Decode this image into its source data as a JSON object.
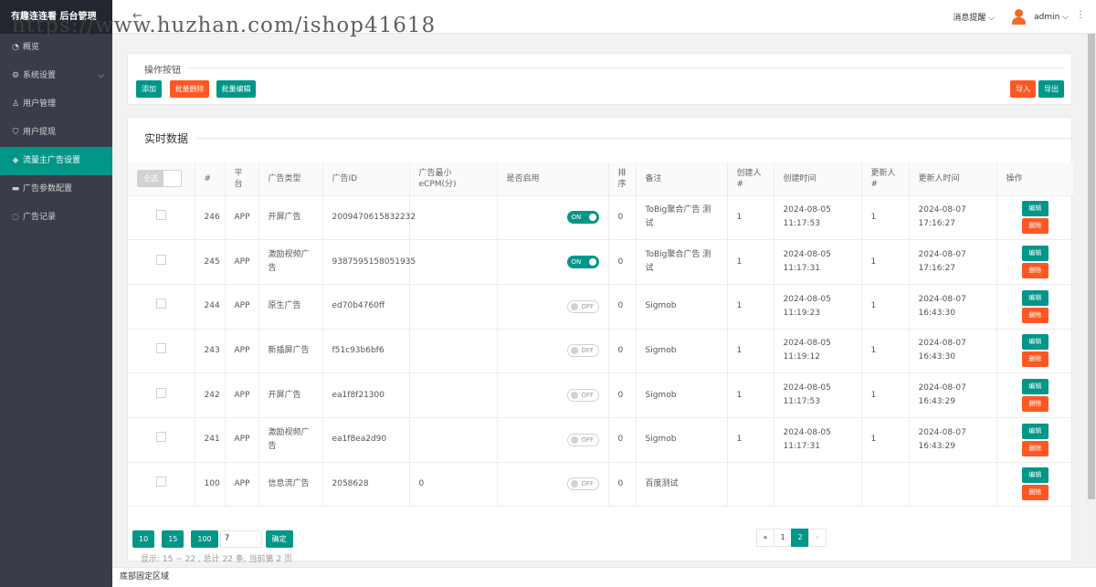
{
  "app": {
    "title": "有趣连连看 后台管理",
    "watermark": "https://www.huzhan.com/ishop41618"
  },
  "sidebar": {
    "items": [
      {
        "label": "概览",
        "icon": "dashboard-icon"
      },
      {
        "label": "系统设置",
        "icon": "gear-icon"
      },
      {
        "label": "用户管理",
        "icon": "user-icon"
      },
      {
        "label": "用户提现",
        "icon": "shield-icon"
      },
      {
        "label": "流量主广告设置",
        "icon": "diamond-icon",
        "active": true
      },
      {
        "label": "广告参数配置",
        "icon": "gamepad-icon"
      },
      {
        "label": "广告记录",
        "icon": "record-icon"
      }
    ]
  },
  "header": {
    "notifications": "消息提醒",
    "user": "admin"
  },
  "ops": {
    "legend": "操作按钮",
    "add": "添加",
    "batch_delete": "批量删除",
    "batch_edit": "批量编辑",
    "import": "导入",
    "export": "导出"
  },
  "table": {
    "title": "实时数据",
    "select_all": "全选",
    "columns": [
      "#",
      "平台",
      "广告类型",
      "广告ID",
      "广告最小eCPM(分)",
      "是否启用",
      "排序",
      "备注",
      "创建人#",
      "创建时间",
      "更新人#",
      "更新人时间",
      "操作"
    ],
    "rows": [
      {
        "id": "246",
        "platform": "APP",
        "type": "开屏广告",
        "ad_id": "2009470615832232",
        "ecpm": "",
        "enabled": "ON",
        "sort": "0",
        "note": "ToBig聚合广告 测试",
        "creator": "1",
        "created": "2024-08-05 11:17:53",
        "updater": "1",
        "updated": "2024-08-07 17:16:27"
      },
      {
        "id": "245",
        "platform": "APP",
        "type": "激励视频广告",
        "ad_id": "9387595158051935",
        "ecpm": "",
        "enabled": "ON",
        "sort": "0",
        "note": "ToBig聚合广告 测试",
        "creator": "1",
        "created": "2024-08-05 11:17:31",
        "updater": "1",
        "updated": "2024-08-07 17:16:27"
      },
      {
        "id": "244",
        "platform": "APP",
        "type": "原生广告",
        "ad_id": "ed70b4760ff",
        "ecpm": "",
        "enabled": "OFF",
        "sort": "0",
        "note": "Sigmob",
        "creator": "1",
        "created": "2024-08-05 11:19:23",
        "updater": "1",
        "updated": "2024-08-07 16:43:30"
      },
      {
        "id": "243",
        "platform": "APP",
        "type": "新插屏广告",
        "ad_id": "f51c93b6bf6",
        "ecpm": "",
        "enabled": "OFF",
        "sort": "0",
        "note": "Sigmob",
        "creator": "1",
        "created": "2024-08-05 11:19:12",
        "updater": "1",
        "updated": "2024-08-07 16:43:30"
      },
      {
        "id": "242",
        "platform": "APP",
        "type": "开屏广告",
        "ad_id": "ea1f8f21300",
        "ecpm": "",
        "enabled": "OFF",
        "sort": "0",
        "note": "Sigmob",
        "creator": "1",
        "created": "2024-08-05 11:17:53",
        "updater": "1",
        "updated": "2024-08-07 16:43:29"
      },
      {
        "id": "241",
        "platform": "APP",
        "type": "激励视频广告",
        "ad_id": "ea1f8ea2d90",
        "ecpm": "",
        "enabled": "OFF",
        "sort": "0",
        "note": "Sigmob",
        "creator": "1",
        "created": "2024-08-05 11:17:31",
        "updater": "1",
        "updated": "2024-08-07 16:43:29"
      },
      {
        "id": "100",
        "platform": "APP",
        "type": "信息流广告",
        "ad_id": "2058628",
        "ecpm": "0",
        "enabled": "OFF",
        "sort": "0",
        "note": "百度测试",
        "creator": "",
        "created": "",
        "updater": "",
        "updated": ""
      }
    ],
    "edit_label": "编辑",
    "delete_label": "删除"
  },
  "pager": {
    "sizes": [
      "10",
      "15",
      "100"
    ],
    "input_value": "7",
    "confirm": "确定",
    "info": "显示: 15 ~ 22 , 总计 22 条,  当前第 2 页",
    "prev": "«",
    "pages": [
      "1",
      "2"
    ],
    "current": "2",
    "next": "»"
  },
  "footer": {
    "text": "底部固定区域"
  }
}
